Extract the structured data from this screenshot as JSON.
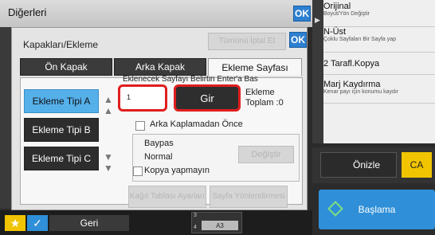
{
  "header": {
    "title": "Diğerleri",
    "ok_label": "OK"
  },
  "dialog": {
    "title": "Kapakları/Ekleme",
    "clear_all_label": "Tümünü İptal Et",
    "ok_label": "OK",
    "tabs": [
      {
        "label": "Ön Kapak",
        "active": false
      },
      {
        "label": "Arka Kapak",
        "active": false
      },
      {
        "label": "Ekleme Sayfası",
        "active": true
      }
    ],
    "insert_types": [
      "Ekleme Tipi A",
      "Ekleme Tipi B",
      "Ekleme Tipi C"
    ],
    "instruction": "Eklenecek Sayfayı Belirtin Enter'a Bas",
    "page_input_value": "1",
    "enter_label": "Gir",
    "total_label": "Ekleme",
    "total_value": "Toplam :0",
    "back_copy_label": "Arka Kaplamadan Önce",
    "paper_source_title": "Baypas",
    "paper_type": "Normal",
    "no_copy_label": "Kopya yapmayın",
    "change_label": "Değiştir",
    "tray_settings_label": "Kağıt Tablası Ayarları",
    "page_orientation_label": "Sayfa Yönlendirmesi"
  },
  "right_panel": {
    "items": [
      {
        "label": "Orijinal",
        "sub": "Boyut/Yön Değiştir"
      },
      {
        "label": "N-Üst",
        "sub": "Çoklu Sayfaları Bir Sayfa yap"
      },
      {
        "label": "2 Tarafl.Kopya",
        "sub": ""
      },
      {
        "label": "Marj Kaydırma",
        "sub": "Kenar payı için konumu kaydır"
      }
    ],
    "preview_label": "Önizle",
    "ca_label": "CA",
    "start_label": "Başlama"
  },
  "bottom": {
    "back_label": "Geri",
    "paper_size": "A3",
    "counter_top": "3",
    "counter_bottom": "4"
  },
  "colors": {
    "accent_blue": "#2f8fd8",
    "selected": "#55b0ea",
    "highlight": "#e01e1e",
    "ca": "#f0c400"
  }
}
